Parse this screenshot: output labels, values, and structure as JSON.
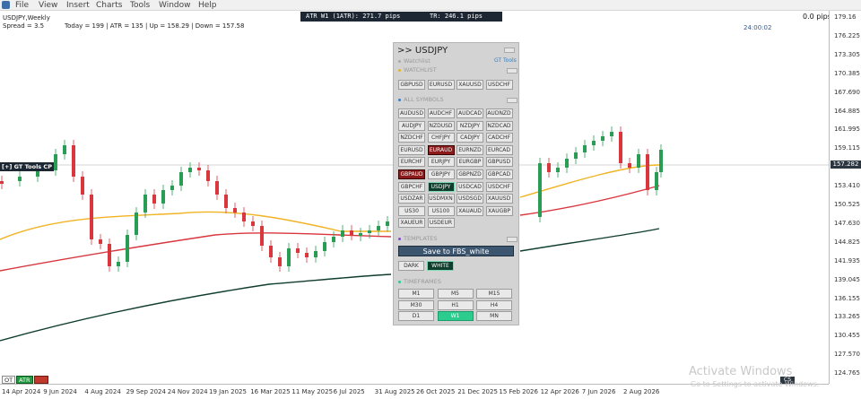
{
  "menu": [
    "File",
    "View",
    "Insert",
    "Charts",
    "Tools",
    "Window",
    "Help"
  ],
  "chart_header": {
    "symbol": "USDJPY,Weekly",
    "spread": "Spread = 3.5",
    "stats": "Today = 199 | ATR = 135 | Up = 158.29 | Down = 157.58"
  },
  "atr_bar": {
    "atr": "ATR W1 (1ATR): 271.7 pips",
    "tr": "TR: 246.1 pips"
  },
  "spread_top": "0.0 pips",
  "timer": "24:00:02",
  "gt_label": "[+] GT Tools CP",
  "price_axis": {
    "ticks": [
      "179.16",
      "176.225",
      "173.305",
      "170.385",
      "167.690",
      "164.885",
      "161.995",
      "159.115",
      "156.215",
      "153.410",
      "150.525",
      "147.630",
      "144.825",
      "141.935",
      "139.045",
      "136.155",
      "133.265",
      "130.455",
      "127.570",
      "124.765"
    ],
    "current": "157.282"
  },
  "time_axis": [
    "14 Apr 2024",
    "9 Jun 2024",
    "4 Aug 2024",
    "29 Sep 2024",
    "24 Nov 2024",
    "19 Jan 2025",
    "16 Mar 2025",
    "11 May 2025",
    "6 Jul 2025",
    "31 Aug 2025",
    "26 Oct 2025",
    "21 Dec 2025",
    "15 Feb 2026",
    "12 Apr 2026",
    "7 Jun 2026",
    "2 Aug 2026"
  ],
  "bottom_tabs": [
    "OT",
    "ATR",
    ""
  ],
  "cs_label": "CS",
  "watermark": {
    "title": "Activate Windows",
    "sub": "Go to Settings to activate Windows."
  },
  "panel": {
    "title": ">> USDJPY",
    "watchlist_top": "Watchlist",
    "gt_tools": "GT Tools",
    "watchlist_label": "WATCHLIST",
    "watchlist": [
      "GBPUSD",
      "EURUSD",
      "XAUUSD",
      "USDCHF"
    ],
    "all_symbols_label": "ALL SYMBOLS",
    "symbols": [
      [
        "AUDUSD",
        "AUDCHF",
        "AUDCAD",
        "AUDNZD"
      ],
      [
        "AUDJPY",
        "NZDUSD",
        "NZDJPY",
        "NZDCAD"
      ],
      [
        "NZDCHF",
        "CHFJPY",
        "CADJPY",
        "CADCHF"
      ],
      [
        "EURUSD",
        "EURAUD",
        "EURNZD",
        "EURCAD"
      ],
      [
        "EURCHF",
        "EURJPY",
        "EURGBP",
        "GBPUSD"
      ],
      [
        "GBPAUD",
        "GBPJPY",
        "GBPNZD",
        "GBPCAD"
      ],
      [
        "GBPCHF",
        "USDJPY",
        "USDCAD",
        "USDCHF"
      ],
      [
        "USDZAR",
        "USDMXN",
        "USDSGD",
        "XAUUSD"
      ],
      [
        "US30",
        "US100",
        "XAUAUD",
        "XAUGBP"
      ],
      [
        "XAUEUR",
        "USDEUR"
      ]
    ],
    "templates_label": "TEMPLATES",
    "save_label": "Save to FBS_white",
    "dark_label": "DARK",
    "white_label": "WHITE",
    "timeframes_label": "TIMEFRAMES",
    "timeframes": [
      "M1",
      "M5",
      "M15",
      "M30",
      "H1",
      "H4",
      "D1",
      "W1",
      "MN"
    ],
    "active_timeframe": "W1"
  }
}
